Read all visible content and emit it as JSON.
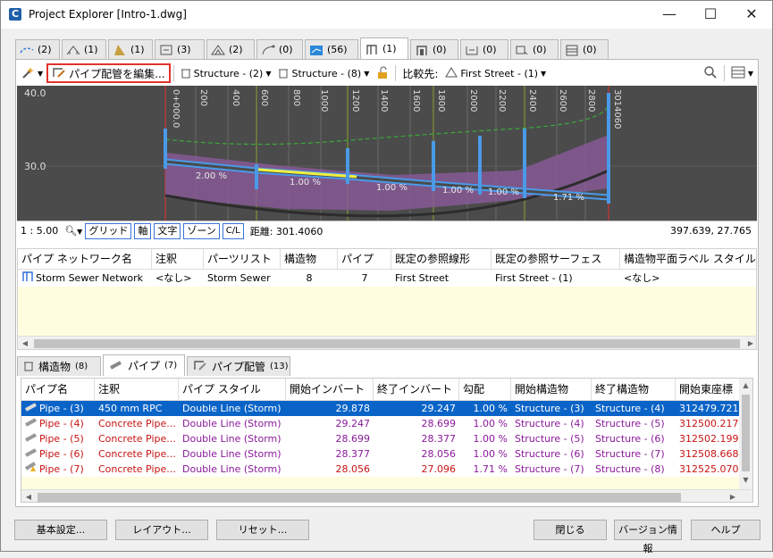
{
  "window": {
    "title": "Project Explorer [Intro-1.dwg]",
    "minimize": "—",
    "maximize": "☐",
    "close": "✕"
  },
  "top_tabs": [
    {
      "icon": "alignment-icon",
      "count": "(2)"
    },
    {
      "icon": "bridge-icon",
      "count": "(1)"
    },
    {
      "icon": "corridor-icon",
      "count": "(1)"
    },
    {
      "icon": "assembly-icon",
      "count": "(3)"
    },
    {
      "icon": "surface-icon",
      "count": "(2)"
    },
    {
      "icon": "featureline-icon",
      "count": "(0)"
    },
    {
      "icon": "profile-view-icon",
      "count": "(56)"
    },
    {
      "icon": "pipe-network-icon",
      "count": "(1)"
    },
    {
      "icon": "pressure-network-icon",
      "count": "(0)"
    },
    {
      "icon": "section-icon",
      "count": "(0)"
    },
    {
      "icon": "point-group-icon",
      "count": "(0)"
    },
    {
      "icon": "parcel-icon",
      "count": "(0)"
    }
  ],
  "toolbar": {
    "edit_layout": "パイプ配管を編集...",
    "structure_start": "Structure - (2)",
    "structure_end": "Structure - (8)",
    "compare_label": "比較先:",
    "compare_value": "First Street - (1)"
  },
  "profile": {
    "y_labels": [
      "40.0",
      "30.0"
    ],
    "stations": [
      "0+000.0",
      "200",
      "400",
      "600",
      "800",
      "1000",
      "1200",
      "1400",
      "1600",
      "1800",
      "2000",
      "2200",
      "2400",
      "2600",
      "2800",
      "3014060"
    ],
    "slopes": [
      "2.00 %",
      "1.00 %",
      "1.00 %",
      "1.00 %",
      "1.00 %",
      "1.71 %"
    ]
  },
  "statusbar": {
    "scale": "1 : 5.00",
    "grid": "グリッド",
    "axis": "軸",
    "text": "文字",
    "zone": "ゾーン",
    "cl": "C/L",
    "distance": "距離: 301.4060",
    "coords": "397.639, 27.765"
  },
  "network_grid": {
    "headers": [
      "パイプ ネットワーク名",
      "注釈",
      "パーツリスト",
      "構造物",
      "パイプ",
      "既定の参照線形",
      "既定の参照サーフェス",
      "構造物平面ラベル スタイル"
    ],
    "row": [
      "Storm Sewer Network",
      "<なし>",
      "Storm Sewer",
      "8",
      "7",
      "First Street",
      "First Street - (1)",
      "<なし>"
    ]
  },
  "sub_tabs": [
    {
      "label": "構造物",
      "count": "(8)"
    },
    {
      "label": "パイプ",
      "count": "(7)"
    },
    {
      "label": "パイプ配管",
      "count": "(13)"
    }
  ],
  "pipe_grid": {
    "headers": [
      "パイプ名",
      "注釈",
      "パイプ スタイル",
      "開始インバート",
      "終了インバート",
      "勾配",
      "開始構造物",
      "終了構造物",
      "開始東座標"
    ],
    "rows": [
      [
        "Pipe - (3)",
        "450 mm RPC",
        "Double Line (Storm)",
        "29.878",
        "29.247",
        "1.00 %",
        "Structure - (3)",
        "Structure - (4)",
        "312479.721"
      ],
      [
        "Pipe - (4)",
        "Concrete Pipe...",
        "Double Line (Storm)",
        "29.247",
        "28.699",
        "1.00 %",
        "Structure - (4)",
        "Structure - (5)",
        "312500.217"
      ],
      [
        "Pipe - (5)",
        "Concrete Pipe...",
        "Double Line (Storm)",
        "28.699",
        "28.377",
        "1.00 %",
        "Structure - (5)",
        "Structure - (6)",
        "312502.199"
      ],
      [
        "Pipe - (6)",
        "Concrete Pipe...",
        "Double Line (Storm)",
        "28.377",
        "28.056",
        "1.00 %",
        "Structure - (6)",
        "Structure - (7)",
        "312508.668"
      ],
      [
        "Pipe - (7)",
        "Concrete Pipe...",
        "Double Line (Storm)",
        "28.056",
        "27.096",
        "1.71 %",
        "Structure - (7)",
        "Structure - (8)",
        "312525.070"
      ]
    ]
  },
  "buttons": {
    "settings": "基本設定...",
    "layout": "レイアウト...",
    "reset": "リセット...",
    "close": "閉じる",
    "version": "バージョン情報",
    "help": "ヘルプ"
  }
}
